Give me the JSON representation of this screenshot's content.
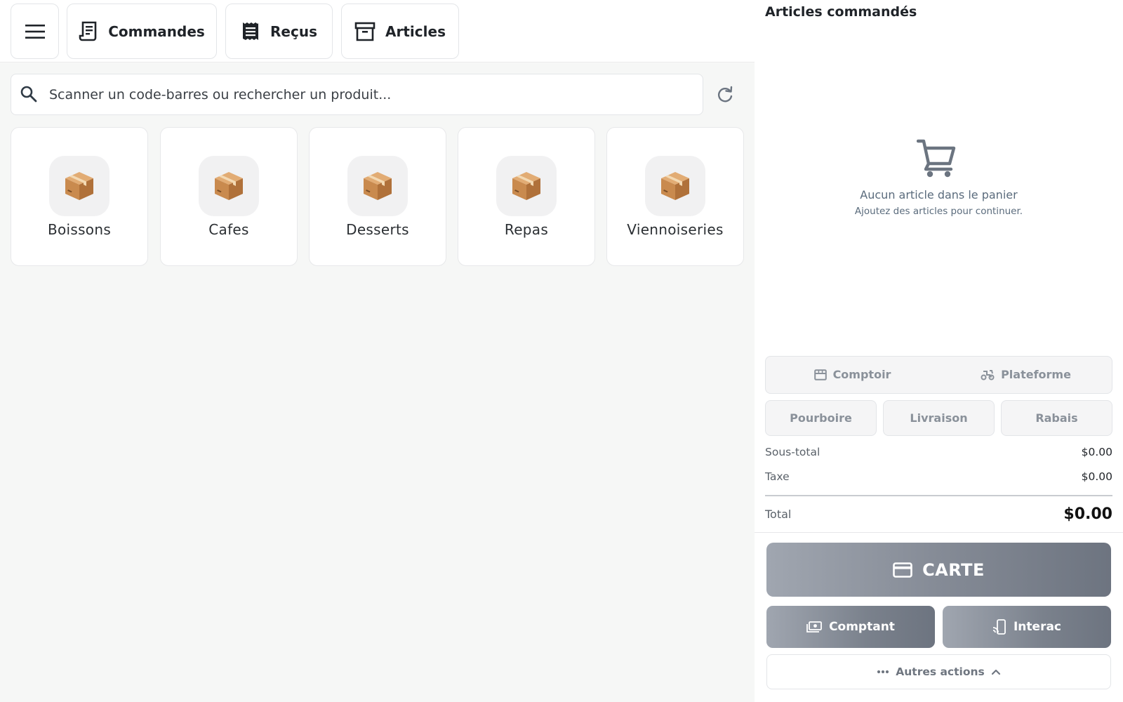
{
  "toolbar": {
    "menu_icon": "hamburger-menu-icon",
    "commandes_label": "Commandes",
    "recus_label": "Reçus",
    "articles_label": "Articles"
  },
  "search": {
    "placeholder": "Scanner un code-barres ou rechercher un produit..."
  },
  "categories": [
    {
      "label": "Boissons",
      "icon": "package-box-icon"
    },
    {
      "label": "Cafes",
      "icon": "package-box-icon"
    },
    {
      "label": "Desserts",
      "icon": "package-box-icon"
    },
    {
      "label": "Repas",
      "icon": "package-box-icon"
    },
    {
      "label": "Viennoiseries",
      "icon": "package-box-icon"
    }
  ],
  "cart": {
    "title": "Articles commandés",
    "empty_title": "Aucun article dans le panier",
    "empty_subtitle": "Ajoutez des articles pour continuer."
  },
  "order_type": {
    "comptoir": "Comptoir",
    "plateforme": "Plateforme"
  },
  "adjustments": {
    "pourboire": "Pourboire",
    "livraison": "Livraison",
    "rabais": "Rabais"
  },
  "totals": {
    "subtotal_label": "Sous-total",
    "subtotal_value": "$0.00",
    "tax_label": "Taxe",
    "tax_value": "$0.00",
    "total_label": "Total",
    "total_value": "$0.00"
  },
  "payment": {
    "carte_label": "CARTE",
    "comptant_label": "Comptant",
    "interac_label": "Interac",
    "more_label": "Autres actions"
  },
  "colors": {
    "accent_gray": "#858b96",
    "muted_text": "#5a6b7c",
    "background": "#f6f7f6"
  }
}
